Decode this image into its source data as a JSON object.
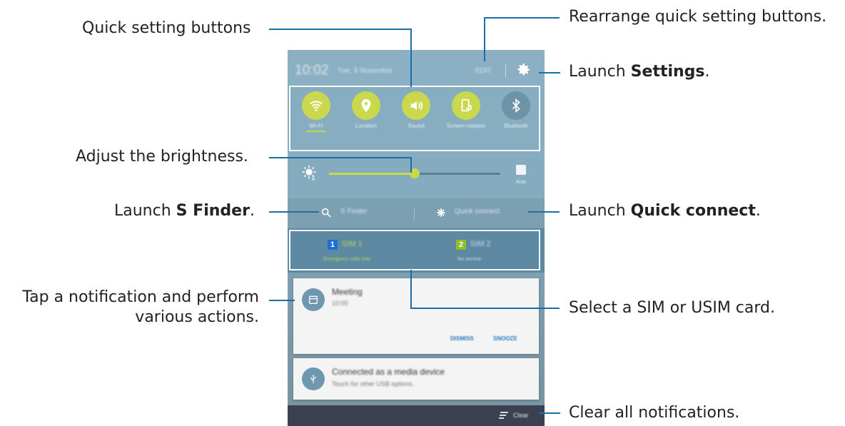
{
  "annotations": {
    "quick_setting_buttons": "Quick setting buttons",
    "rearrange": "Rearrange quick setting buttons.",
    "launch_settings_prefix": "Launch ",
    "launch_settings_bold": "Settings",
    "launch_settings_suffix": ".",
    "adjust_brightness": "Adjust the brightness.",
    "launch_sfinder_prefix": "Launch ",
    "launch_sfinder_bold": "S Finder",
    "launch_sfinder_suffix": ".",
    "launch_qc_prefix": "Launch ",
    "launch_qc_bold": "Quick connect",
    "launch_qc_suffix": ".",
    "tap_notification_line1": "Tap a notification and perform",
    "tap_notification_line2": "various actions.",
    "select_sim": "Select a SIM or USIM card.",
    "clear_all": "Clear all notifications."
  },
  "phone": {
    "time": "10:02",
    "date": "Tue, 3 November",
    "edit_label": "EDIT",
    "quick_settings": [
      {
        "label": "Wi-Fi",
        "icon": "wifi-icon",
        "on": true
      },
      {
        "label": "Location",
        "icon": "location-icon",
        "on": true
      },
      {
        "label": "Sound",
        "icon": "sound-icon",
        "on": true
      },
      {
        "label": "Screen rotation",
        "icon": "screen-rotation-icon",
        "on": true
      },
      {
        "label": "Bluetooth",
        "icon": "bluetooth-icon",
        "on": false
      }
    ],
    "brightness": {
      "level": 0.5,
      "auto_label": "Auto"
    },
    "s_finder_label": "S Finder",
    "quick_connect_label": "Quick connect",
    "sims": [
      {
        "number": "1",
        "name": "SIM 1",
        "status": "Emergency calls only",
        "color": "#1e6fd0"
      },
      {
        "number": "2",
        "name": "SIM 2",
        "status": "No service",
        "color": "#8fbd2c"
      }
    ],
    "notifications": [
      {
        "title": "Meeting",
        "subtitle": "10:00",
        "actions": [
          "DISMISS",
          "SNOOZE"
        ]
      },
      {
        "title": "Connected as a media device",
        "subtitle": "Touch for other USB options."
      }
    ],
    "clear_label": "Clear"
  },
  "colors": {
    "accent": "#c9d84c",
    "leader_line": "#1c6fa6"
  }
}
